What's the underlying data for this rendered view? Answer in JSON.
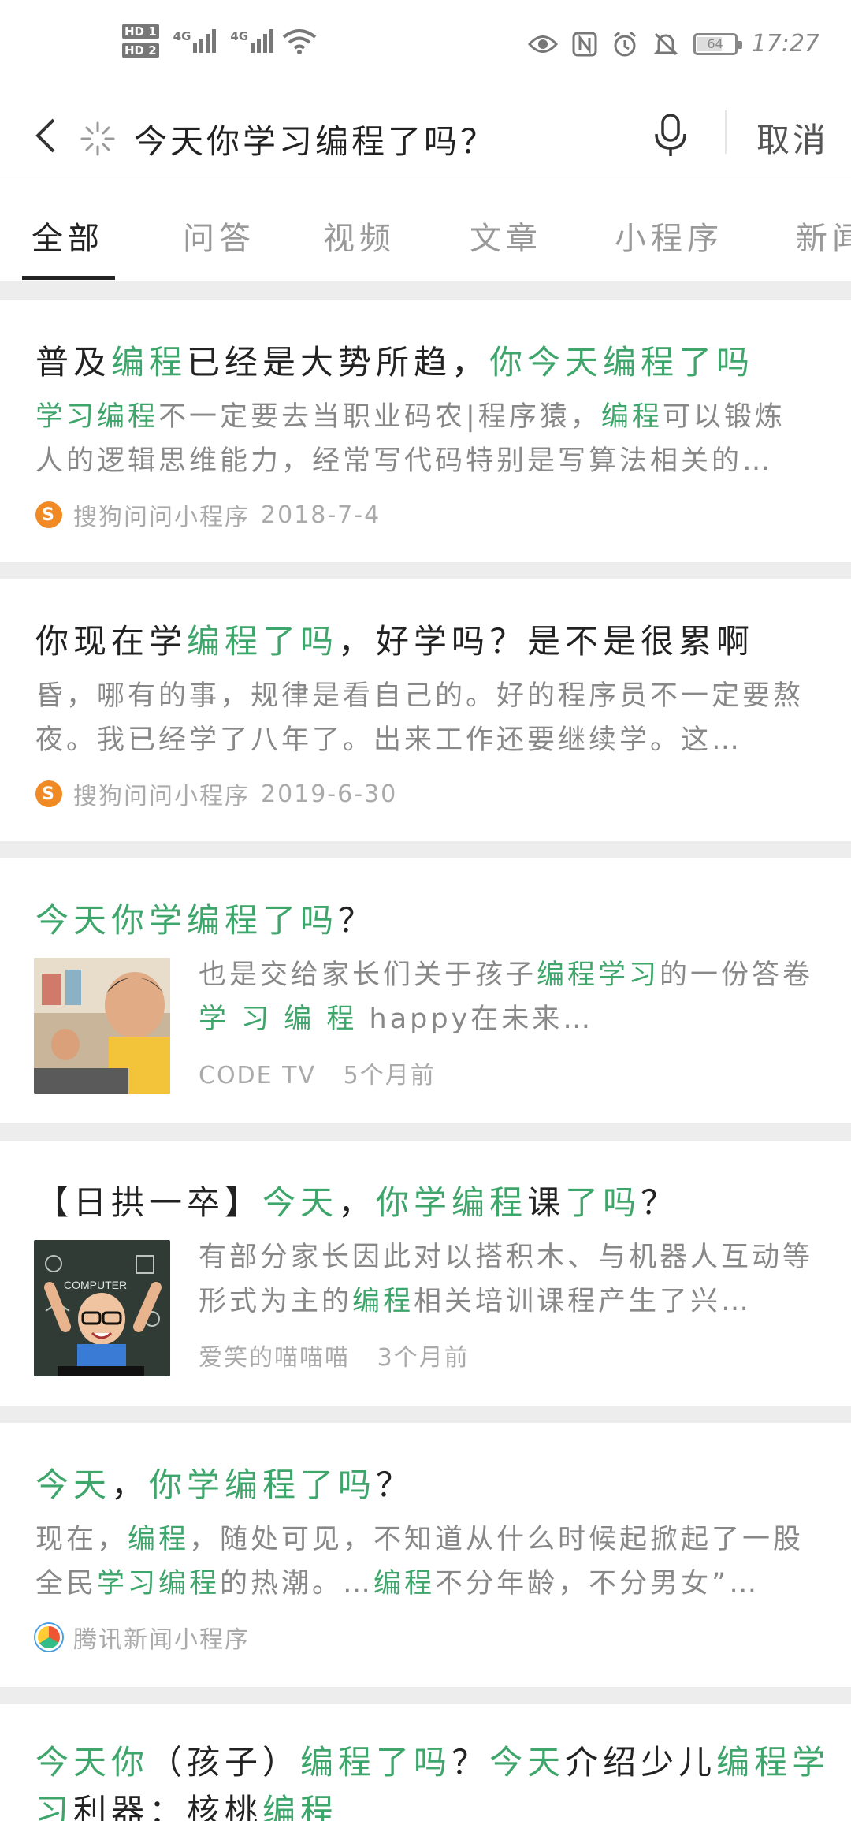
{
  "status": {
    "hd1": "HD 1",
    "hd2": "HD 2",
    "net1": "4G",
    "net2": "4G",
    "battery": "64",
    "time": "17:27"
  },
  "search": {
    "query": "今天你学习编程了吗？",
    "cancel": "取消"
  },
  "tabs": [
    "全部",
    "问答",
    "视频",
    "文章",
    "小程序",
    "新闻"
  ],
  "results": [
    {
      "title": [
        {
          "t": "普及"
        },
        {
          "t": "编程",
          "g": true
        },
        {
          "t": "已经是大势所趋，"
        },
        {
          "t": "你今天编程了吗",
          "g": true
        }
      ],
      "desc": [
        {
          "t": "学习编程",
          "g": true
        },
        {
          "t": "不一定要去当职业码农|程序猿，"
        },
        {
          "t": "编程",
          "g": true
        },
        {
          "t": "可以锻炼人的逻辑思维能力，经常写代码特别是写算法相关的…"
        }
      ],
      "source": "搜狗问问小程序",
      "date": "2018-7-4"
    },
    {
      "title": [
        {
          "t": "你现在学"
        },
        {
          "t": "编程了吗",
          "g": true
        },
        {
          "t": "，好学吗？是不是很累啊"
        }
      ],
      "desc": [
        {
          "t": "昏，哪有的事，规律是看自己的。好的程序员不一定要熬夜。我已经学了八年了。出来工作还要继续学。这…"
        }
      ],
      "source": "搜狗问问小程序",
      "date": "2019-6-30"
    },
    {
      "title": [
        {
          "t": "今天你学编程了吗",
          "g": true
        },
        {
          "t": "？"
        }
      ],
      "desc": [
        {
          "t": "也是交给家长们关于孩子"
        },
        {
          "t": "编程学习",
          "g": true
        },
        {
          "t": "的一份答卷 "
        },
        {
          "t": "学 习 编 程",
          "g": true
        },
        {
          "t": " happy在未来…"
        }
      ],
      "source": "CODE TV",
      "date": "5个月前"
    },
    {
      "title": [
        {
          "t": "【日拱一卒】"
        },
        {
          "t": "今天",
          "g": true
        },
        {
          "t": "，"
        },
        {
          "t": "你学编程",
          "g": true
        },
        {
          "t": "课"
        },
        {
          "t": "了吗",
          "g": true
        },
        {
          "t": "？"
        }
      ],
      "desc": [
        {
          "t": "有部分家长因此对以搭积木、与机器人互动等形式为主的"
        },
        {
          "t": "编程",
          "g": true
        },
        {
          "t": "相关培训课程产生了兴…"
        }
      ],
      "source": "爱笑的喵喵喵",
      "date": "3个月前"
    },
    {
      "title": [
        {
          "t": "今天",
          "g": true
        },
        {
          "t": "，"
        },
        {
          "t": "你学编程了吗",
          "g": true
        },
        {
          "t": "？"
        }
      ],
      "desc": [
        {
          "t": "现在，"
        },
        {
          "t": "编程",
          "g": true
        },
        {
          "t": "，随处可见，不知道从什么时候起掀起了一股全民"
        },
        {
          "t": "学习编程",
          "g": true
        },
        {
          "t": "的热潮。…"
        },
        {
          "t": "编程",
          "g": true
        },
        {
          "t": "不分年龄，不分男女”…"
        }
      ],
      "source": "腾讯新闻小程序",
      "date": ""
    },
    {
      "title": [
        {
          "t": "今天你",
          "g": true
        },
        {
          "t": "（孩子）"
        },
        {
          "t": "编程了吗",
          "g": true
        },
        {
          "t": "？"
        },
        {
          "t": "今天",
          "g": true
        },
        {
          "t": "介绍少儿"
        },
        {
          "t": "编程学",
          "g": true
        }
      ],
      "title2": [
        {
          "t": "习",
          "g": true
        },
        {
          "t": "利器：核桃"
        },
        {
          "t": "编程",
          "g": true
        }
      ],
      "desc": [],
      "source": "",
      "date": ""
    }
  ],
  "thumb_text": "COMPUTER"
}
